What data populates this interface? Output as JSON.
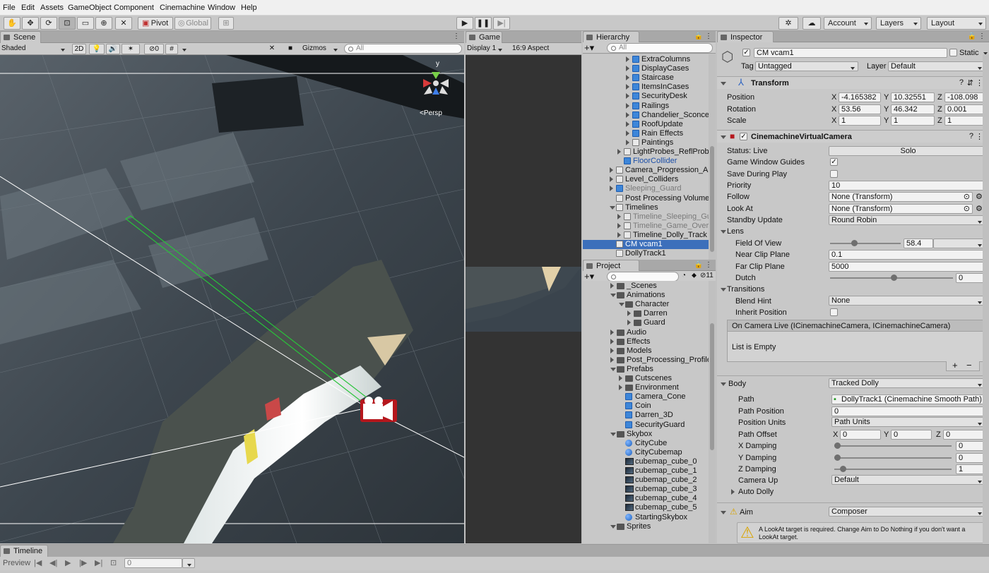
{
  "menu": [
    "File",
    "Edit",
    "Assets",
    "GameObject",
    "Component",
    "Cinemachine",
    "Window",
    "Help"
  ],
  "toolbar": {
    "pivot": "Pivot",
    "global": "Global",
    "account": "Account",
    "layers": "Layers",
    "layout": "Layout"
  },
  "scene": {
    "tab": "Scene",
    "shading": "Shaded",
    "mode2d": "2D",
    "hidden_count": "0",
    "gizmos": "Gizmos",
    "search_placeholder": "All",
    "persp": "<Persp",
    "gizmo_axis": "y"
  },
  "game": {
    "tab": "Game",
    "display": "Display 1",
    "aspect": "16:9 Aspect"
  },
  "hierarchy": {
    "tab": "Hierarchy",
    "search_placeholder": "All",
    "items": [
      {
        "label": "ExtraColumns",
        "style": "normal",
        "icon": "cube",
        "arrow": "r"
      },
      {
        "label": "DisplayCases",
        "style": "normal",
        "icon": "cube",
        "arrow": "r"
      },
      {
        "label": "Staircase",
        "style": "normal",
        "icon": "cube",
        "arrow": "r"
      },
      {
        "label": "ItemsInCases",
        "style": "normal",
        "icon": "cube",
        "arrow": "r"
      },
      {
        "label": "SecurityDesk",
        "style": "normal",
        "icon": "cube",
        "arrow": "r"
      },
      {
        "label": "Railings",
        "style": "normal",
        "icon": "cube",
        "arrow": "r"
      },
      {
        "label": "Chandelier_Sconce",
        "style": "normal",
        "icon": "cube",
        "arrow": "r"
      },
      {
        "label": "RoofUpdate",
        "style": "normal",
        "icon": "cube",
        "arrow": "r"
      },
      {
        "label": "Rain Effects",
        "style": "normal",
        "icon": "cube",
        "arrow": "r"
      },
      {
        "label": "Paintings",
        "style": "normal",
        "icon": "hollow",
        "arrow": "r"
      },
      {
        "label": "LightProbes_ReflProbe",
        "style": "normal",
        "icon": "hollow",
        "arrow": "r"
      },
      {
        "label": "FloorCollider",
        "style": "blue",
        "icon": "cube",
        "arrow": ""
      },
      {
        "label": "Camera_Progression_And",
        "style": "normal",
        "icon": "hollow",
        "arrow": "r"
      },
      {
        "label": "Level_Colliders",
        "style": "normal",
        "icon": "hollow",
        "arrow": "r"
      },
      {
        "label": "Sleeping_Guard",
        "style": "gray",
        "icon": "cube",
        "arrow": "r"
      },
      {
        "label": "Post Processing Volume",
        "style": "normal",
        "icon": "hollow",
        "arrow": ""
      },
      {
        "label": "Timelines",
        "style": "normal",
        "icon": "hollow",
        "arrow": "d"
      },
      {
        "label": "Timeline_Sleeping_Gu",
        "style": "gray",
        "icon": "hollow",
        "arrow": "r"
      },
      {
        "label": "Timeline_Game_Over",
        "style": "gray",
        "icon": "hollow",
        "arrow": "r"
      },
      {
        "label": "Timeline_Dolly_Track",
        "style": "normal",
        "icon": "hollow",
        "arrow": "r"
      },
      {
        "label": "CM vcam1",
        "style": "sel",
        "icon": "hollow",
        "arrow": ""
      },
      {
        "label": "DollyTrack1",
        "style": "normal",
        "icon": "hollow",
        "arrow": ""
      }
    ]
  },
  "project": {
    "tab": "Project",
    "hidden_count": "11",
    "items": [
      {
        "label": "_Scenes",
        "icon": "folder",
        "arrow": "r"
      },
      {
        "label": "Animations",
        "icon": "folder",
        "arrow": "d"
      },
      {
        "label": "Character",
        "icon": "folder",
        "arrow": "d"
      },
      {
        "label": "Darren",
        "icon": "folder",
        "arrow": "r"
      },
      {
        "label": "Guard",
        "icon": "folder",
        "arrow": "r"
      },
      {
        "label": "Audio",
        "icon": "folder",
        "arrow": "r"
      },
      {
        "label": "Effects",
        "icon": "folder",
        "arrow": "r"
      },
      {
        "label": "Models",
        "icon": "folder",
        "arrow": "r"
      },
      {
        "label": "Post_Processing_Profiles",
        "icon": "folder",
        "arrow": "r"
      },
      {
        "label": "Prefabs",
        "icon": "folder",
        "arrow": "d"
      },
      {
        "label": "Cutscenes",
        "icon": "folder",
        "arrow": "r"
      },
      {
        "label": "Environment",
        "icon": "folder",
        "arrow": "r"
      },
      {
        "label": "Camera_Cone",
        "icon": "cube",
        "arrow": ""
      },
      {
        "label": "Coin",
        "icon": "cube",
        "arrow": ""
      },
      {
        "label": "Darren_3D",
        "icon": "cube",
        "arrow": ""
      },
      {
        "label": "SecurityGuard",
        "icon": "cube",
        "arrow": ""
      },
      {
        "label": "Skybox",
        "icon": "folder",
        "arrow": "d"
      },
      {
        "label": "CityCube",
        "icon": "sphere",
        "arrow": ""
      },
      {
        "label": "CityCubemap",
        "icon": "sphere",
        "arrow": ""
      },
      {
        "label": "cubemap_cube_0",
        "icon": "tex",
        "arrow": ""
      },
      {
        "label": "cubemap_cube_1",
        "icon": "tex",
        "arrow": ""
      },
      {
        "label": "cubemap_cube_2",
        "icon": "tex",
        "arrow": ""
      },
      {
        "label": "cubemap_cube_3",
        "icon": "tex",
        "arrow": ""
      },
      {
        "label": "cubemap_cube_4",
        "icon": "tex",
        "arrow": ""
      },
      {
        "label": "cubemap_cube_5",
        "icon": "tex",
        "arrow": ""
      },
      {
        "label": "StartingSkybox",
        "icon": "sphere",
        "arrow": ""
      },
      {
        "label": "Sprites",
        "icon": "folder",
        "arrow": "d"
      }
    ]
  },
  "inspector": {
    "tab": "Inspector",
    "object_name": "CM vcam1",
    "static_label": "Static",
    "tag_label": "Tag",
    "tag_value": "Untagged",
    "layer_label": "Layer",
    "layer_value": "Default",
    "transform": {
      "title": "Transform",
      "position_label": "Position",
      "px": "-4.165382",
      "py": "10.32551",
      "pz": "-108.098",
      "rotation_label": "Rotation",
      "rx": "53.56",
      "ry": "46.342",
      "rz": "0.001",
      "scale_label": "Scale",
      "sx": "1",
      "sy": "1",
      "sz": "1",
      "x": "X",
      "y": "Y",
      "z": "Z"
    },
    "vcam": {
      "title": "CinemachineVirtualCamera",
      "status_label": "Status: Live",
      "solo": "Solo",
      "game_window_guides": "Game Window Guides",
      "save_during_play": "Save During Play",
      "priority_label": "Priority",
      "priority": "10",
      "follow_label": "Follow",
      "follow": "None (Transform)",
      "lookat_label": "Look At",
      "lookat": "None (Transform)",
      "standby_label": "Standby Update",
      "standby": "Round Robin",
      "lens": "Lens",
      "fov_label": "Field Of View",
      "fov": "58.4",
      "near_label": "Near Clip Plane",
      "near": "0.1",
      "far_label": "Far Clip Plane",
      "far": "5000",
      "dutch_label": "Dutch",
      "dutch": "0",
      "transitions": "Transitions",
      "blend_label": "Blend Hint",
      "blend": "None",
      "inherit_label": "Inherit Position",
      "event_title": "On Camera Live (ICinemachineCamera, ICinemachineCamera)",
      "event_empty": "List is Empty",
      "plus": "+",
      "minus": "−"
    },
    "body": {
      "label": "Body",
      "value": "Tracked Dolly",
      "path_label": "Path",
      "path": "DollyTrack1 (Cinemachine Smooth Path)",
      "pathpos_label": "Path Position",
      "pathpos": "0",
      "units_label": "Position Units",
      "units": "Path Units",
      "offset_label": "Path Offset",
      "ox": "0",
      "oy": "0",
      "oz": "0",
      "xd_label": "X Damping",
      "xd": "0",
      "yd_label": "Y Damping",
      "yd": "0",
      "zd_label": "Z Damping",
      "zd": "1",
      "up_label": "Camera Up",
      "up": "Default",
      "auto_label": "Auto Dolly"
    },
    "aim": {
      "label": "Aim",
      "value": "Composer",
      "warning": "A LookAt target is required.  Change Aim to Do Nothing if you don't want a LookAt target."
    }
  },
  "timeline": {
    "tab": "Timeline",
    "preview": "Preview",
    "frame": "0"
  },
  "colors": {
    "selection": "#3c6fbb",
    "prefab_blue": "#1c4fa7",
    "panel": "#c8c8c8"
  },
  "slider_levels": {
    "fov": 0.33,
    "dutch": 0.52,
    "xd": 0.0,
    "yd": 0.0,
    "zd": 0.05
  }
}
